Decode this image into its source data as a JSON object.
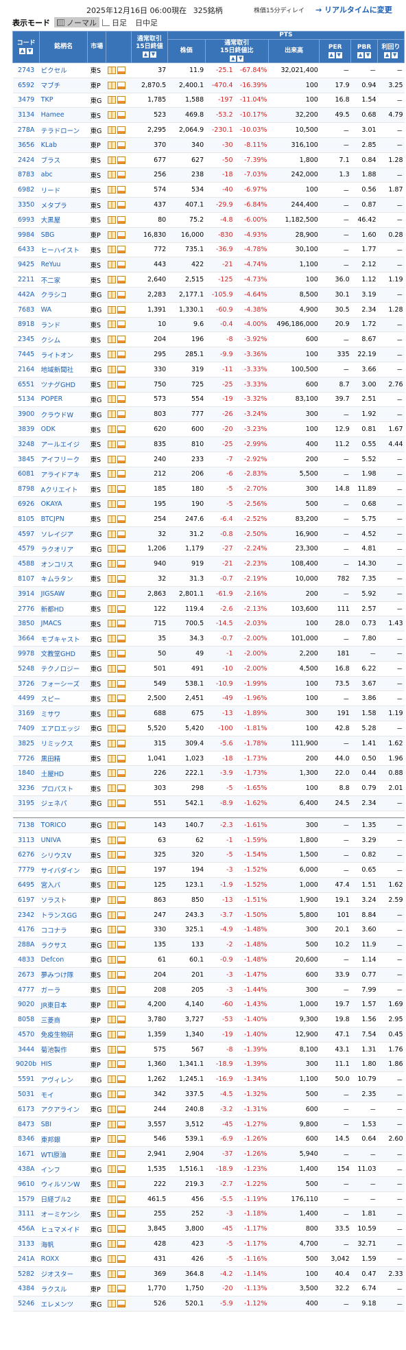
{
  "header": {
    "datetime": "2025年12月16日 06:00現在",
    "count": "325銘柄",
    "delay": "株価15分ディレイ",
    "realtime_link": "→ リアルタイムに変更"
  },
  "mode": {
    "label": "表示モード",
    "normal": "ノーマル",
    "daily": "日足",
    "intraday": "日中足"
  },
  "columns": {
    "code": "コード",
    "name": "銘柄名",
    "market": "市場",
    "prev_close": "通常取引\n15日終値",
    "pts": "PTS",
    "price": "株価",
    "change": "通常取引\n15日終値比",
    "volume": "出来高",
    "per": "PER",
    "pbr": "PBR",
    "yield": "利回り"
  },
  "rows": [
    [
      "2743",
      "ピクセル",
      "東S",
      "37",
      "11.9",
      "-25.1",
      "-67.84%",
      "32,021,400",
      "－",
      "－",
      "－"
    ],
    [
      "6592",
      "マブチ",
      "東P",
      "2,870.5",
      "2,400.1",
      "-470.4",
      "-16.39%",
      "100",
      "17.9",
      "0.94",
      "3.25"
    ],
    [
      "3479",
      "TKP",
      "東G",
      "1,785",
      "1,588",
      "-197",
      "-11.04%",
      "100",
      "16.8",
      "1.54",
      "－"
    ],
    [
      "3134",
      "Hamee",
      "東S",
      "523",
      "469.8",
      "-53.2",
      "-10.17%",
      "32,200",
      "49.5",
      "0.68",
      "4.79"
    ],
    [
      "278A",
      "テラドローン",
      "東G",
      "2,295",
      "2,064.9",
      "-230.1",
      "-10.03%",
      "10,500",
      "－",
      "3.01",
      "－"
    ],
    [
      "3656",
      "KLab",
      "東P",
      "370",
      "340",
      "-30",
      "-8.11%",
      "316,100",
      "－",
      "2.85",
      "－"
    ],
    [
      "2424",
      "ブラス",
      "東S",
      "677",
      "627",
      "-50",
      "-7.39%",
      "1,800",
      "7.1",
      "0.84",
      "1.28"
    ],
    [
      "8783",
      "abc",
      "東S",
      "256",
      "238",
      "-18",
      "-7.03%",
      "242,000",
      "1.3",
      "1.88",
      "－"
    ],
    [
      "6982",
      "リード",
      "東S",
      "574",
      "534",
      "-40",
      "-6.97%",
      "100",
      "－",
      "0.56",
      "1.87"
    ],
    [
      "3350",
      "メタプラ",
      "東S",
      "437",
      "407.1",
      "-29.9",
      "-6.84%",
      "244,400",
      "－",
      "0.87",
      "－"
    ],
    [
      "6993",
      "大黒屋",
      "東S",
      "80",
      "75.2",
      "-4.8",
      "-6.00%",
      "1,182,500",
      "－",
      "46.42",
      "－"
    ],
    [
      "9984",
      "SBG",
      "東P",
      "16,830",
      "16,000",
      "-830",
      "-4.93%",
      "28,900",
      "－",
      "1.60",
      "0.28"
    ],
    [
      "6433",
      "ヒーハイスト",
      "東S",
      "772",
      "735.1",
      "-36.9",
      "-4.78%",
      "30,100",
      "－",
      "1.77",
      "－"
    ],
    [
      "9425",
      "ReYuu",
      "東S",
      "443",
      "422",
      "-21",
      "-4.74%",
      "1,100",
      "－",
      "2.12",
      "－"
    ],
    [
      "2211",
      "不二家",
      "東S",
      "2,640",
      "2,515",
      "-125",
      "-4.73%",
      "100",
      "36.0",
      "1.12",
      "1.19"
    ],
    [
      "442A",
      "クラシコ",
      "東G",
      "2,283",
      "2,177.1",
      "-105.9",
      "-4.64%",
      "8,500",
      "30.1",
      "3.19",
      "－"
    ],
    [
      "7683",
      "WA",
      "東G",
      "1,391",
      "1,330.1",
      "-60.9",
      "-4.38%",
      "4,900",
      "30.5",
      "2.34",
      "1.28"
    ],
    [
      "8918",
      "ランド",
      "東S",
      "10",
      "9.6",
      "-0.4",
      "-4.00%",
      "496,186,000",
      "20.9",
      "1.72",
      "－"
    ],
    [
      "2345",
      "クシム",
      "東S",
      "204",
      "196",
      "-8",
      "-3.92%",
      "600",
      "－",
      "8.67",
      "－"
    ],
    [
      "7445",
      "ライトオン",
      "東S",
      "295",
      "285.1",
      "-9.9",
      "-3.36%",
      "100",
      "335",
      "22.19",
      "－"
    ],
    [
      "2164",
      "地域新聞社",
      "東G",
      "330",
      "319",
      "-11",
      "-3.33%",
      "100,500",
      "－",
      "3.66",
      "－"
    ],
    [
      "6551",
      "ツナグGHD",
      "東S",
      "750",
      "725",
      "-25",
      "-3.33%",
      "600",
      "8.7",
      "3.00",
      "2.76"
    ],
    [
      "5134",
      "POPER",
      "東G",
      "573",
      "554",
      "-19",
      "-3.32%",
      "83,100",
      "39.7",
      "2.51",
      "－"
    ],
    [
      "3900",
      "クラウドW",
      "東G",
      "803",
      "777",
      "-26",
      "-3.24%",
      "300",
      "－",
      "1.92",
      "－"
    ],
    [
      "3839",
      "ODK",
      "東S",
      "620",
      "600",
      "-20",
      "-3.23%",
      "100",
      "12.9",
      "0.81",
      "1.67"
    ],
    [
      "3248",
      "アールエイジ",
      "東S",
      "835",
      "810",
      "-25",
      "-2.99%",
      "400",
      "11.2",
      "0.55",
      "4.44"
    ],
    [
      "3845",
      "アイフリーク",
      "東S",
      "240",
      "233",
      "-7",
      "-2.92%",
      "200",
      "－",
      "5.52",
      "－"
    ],
    [
      "6081",
      "アライドアキ",
      "東S",
      "212",
      "206",
      "-6",
      "-2.83%",
      "5,500",
      "－",
      "1.98",
      "－"
    ],
    [
      "8798",
      "Aクリエイト",
      "東S",
      "185",
      "180",
      "-5",
      "-2.70%",
      "300",
      "14.8",
      "11.89",
      "－"
    ],
    [
      "6926",
      "OKAYA",
      "東S",
      "195",
      "190",
      "-5",
      "-2.56%",
      "500",
      "－",
      "0.68",
      "－"
    ],
    [
      "8105",
      "BTCJPN",
      "東S",
      "254",
      "247.6",
      "-6.4",
      "-2.52%",
      "83,200",
      "－",
      "5.75",
      "－"
    ],
    [
      "4597",
      "ソレイジア",
      "東G",
      "32",
      "31.2",
      "-0.8",
      "-2.50%",
      "16,900",
      "－",
      "4.52",
      "－"
    ],
    [
      "4579",
      "ラクオリア",
      "東G",
      "1,206",
      "1,179",
      "-27",
      "-2.24%",
      "23,300",
      "－",
      "4.81",
      "－"
    ],
    [
      "4588",
      "オンコリス",
      "東G",
      "940",
      "919",
      "-21",
      "-2.23%",
      "108,400",
      "－",
      "14.30",
      "－"
    ],
    [
      "8107",
      "キムラタン",
      "東S",
      "32",
      "31.3",
      "-0.7",
      "-2.19%",
      "10,000",
      "782",
      "7.35",
      "－"
    ],
    [
      "3914",
      "JIGSAW",
      "東G",
      "2,863",
      "2,801.1",
      "-61.9",
      "-2.16%",
      "200",
      "－",
      "5.92",
      "－"
    ],
    [
      "2776",
      "新都HD",
      "東S",
      "122",
      "119.4",
      "-2.6",
      "-2.13%",
      "103,600",
      "111",
      "2.57",
      "－"
    ],
    [
      "3850",
      "JMACS",
      "東S",
      "715",
      "700.5",
      "-14.5",
      "-2.03%",
      "100",
      "28.0",
      "0.73",
      "1.43"
    ],
    [
      "3664",
      "モブキャスト",
      "東G",
      "35",
      "34.3",
      "-0.7",
      "-2.00%",
      "101,000",
      "－",
      "7.80",
      "－"
    ],
    [
      "9978",
      "文教堂GHD",
      "東S",
      "50",
      "49",
      "-1",
      "-2.00%",
      "2,200",
      "181",
      "－",
      "－"
    ],
    [
      "5248",
      "テクノロジー",
      "東G",
      "501",
      "491",
      "-10",
      "-2.00%",
      "4,500",
      "16.8",
      "6.22",
      "－"
    ],
    [
      "3726",
      "フォーシーズ",
      "東S",
      "549",
      "538.1",
      "-10.9",
      "-1.99%",
      "100",
      "73.5",
      "3.67",
      "－"
    ],
    [
      "4499",
      "スピー",
      "東S",
      "2,500",
      "2,451",
      "-49",
      "-1.96%",
      "100",
      "－",
      "3.86",
      "－"
    ],
    [
      "3169",
      "ミサワ",
      "東S",
      "688",
      "675",
      "-13",
      "-1.89%",
      "300",
      "191",
      "1.58",
      "1.19"
    ],
    [
      "7409",
      "エアロエッジ",
      "東G",
      "5,520",
      "5,420",
      "-100",
      "-1.81%",
      "100",
      "42.8",
      "5.28",
      "－"
    ],
    [
      "3825",
      "リミックス",
      "東S",
      "315",
      "309.4",
      "-5.6",
      "-1.78%",
      "111,900",
      "－",
      "1.41",
      "1.62"
    ],
    [
      "7726",
      "黒田精",
      "東S",
      "1,041",
      "1,023",
      "-18",
      "-1.73%",
      "200",
      "44.0",
      "0.50",
      "1.96"
    ],
    [
      "1840",
      "土屋HD",
      "東S",
      "226",
      "222.1",
      "-3.9",
      "-1.73%",
      "1,300",
      "22.0",
      "0.44",
      "0.88"
    ],
    [
      "3236",
      "プロパスト",
      "東S",
      "303",
      "298",
      "-5",
      "-1.65%",
      "100",
      "8.8",
      "0.79",
      "2.01"
    ],
    [
      "3195",
      "ジェネパ",
      "東G",
      "551",
      "542.1",
      "-8.9",
      "-1.62%",
      "6,400",
      "24.5",
      "2.34",
      "－"
    ],
    null,
    [
      "7138",
      "TORICO",
      "東G",
      "143",
      "140.7",
      "-2.3",
      "-1.61%",
      "300",
      "－",
      "1.35",
      "－"
    ],
    [
      "3113",
      "UNIVA",
      "東S",
      "63",
      "62",
      "-1",
      "-1.59%",
      "1,800",
      "－",
      "3.29",
      "－"
    ],
    [
      "6276",
      "シリウスV",
      "東S",
      "325",
      "320",
      "-5",
      "-1.54%",
      "1,500",
      "－",
      "0.82",
      "－"
    ],
    [
      "7779",
      "サイバダイン",
      "東G",
      "197",
      "194",
      "-3",
      "-1.52%",
      "6,000",
      "－",
      "0.65",
      "－"
    ],
    [
      "6495",
      "宮入バ",
      "東S",
      "125",
      "123.1",
      "-1.9",
      "-1.52%",
      "1,000",
      "47.4",
      "1.51",
      "1.62"
    ],
    [
      "6197",
      "ソラスト",
      "東P",
      "863",
      "850",
      "-13",
      "-1.51%",
      "1,900",
      "19.1",
      "3.24",
      "2.59"
    ],
    [
      "2342",
      "トランスGG",
      "東G",
      "247",
      "243.3",
      "-3.7",
      "-1.50%",
      "5,800",
      "101",
      "8.84",
      "－"
    ],
    [
      "4176",
      "ココナラ",
      "東G",
      "330",
      "325.1",
      "-4.9",
      "-1.48%",
      "300",
      "20.1",
      "3.60",
      "－"
    ],
    [
      "288A",
      "ラクサス",
      "東G",
      "135",
      "133",
      "-2",
      "-1.48%",
      "500",
      "10.2",
      "11.9",
      "－"
    ],
    [
      "4833",
      "Defcon",
      "東G",
      "61",
      "60.1",
      "-0.9",
      "-1.48%",
      "20,600",
      "－",
      "1.14",
      "－"
    ],
    [
      "2673",
      "夢みつけ隊",
      "東S",
      "204",
      "201",
      "-3",
      "-1.47%",
      "600",
      "33.9",
      "0.77",
      "－"
    ],
    [
      "4777",
      "ガーラ",
      "東S",
      "208",
      "205",
      "-3",
      "-1.44%",
      "300",
      "－",
      "7.99",
      "－"
    ],
    [
      "9020",
      "JR東日本",
      "東P",
      "4,200",
      "4,140",
      "-60",
      "-1.43%",
      "1,000",
      "19.7",
      "1.57",
      "1.69"
    ],
    [
      "8058",
      "三菱商",
      "東P",
      "3,780",
      "3,727",
      "-53",
      "-1.40%",
      "9,300",
      "19.8",
      "1.56",
      "2.95"
    ],
    [
      "4570",
      "免疫生物研",
      "東G",
      "1,359",
      "1,340",
      "-19",
      "-1.40%",
      "12,900",
      "47.1",
      "7.54",
      "0.45"
    ],
    [
      "3444",
      "菊池製作",
      "東S",
      "575",
      "567",
      "-8",
      "-1.39%",
      "8,100",
      "43.1",
      "1.31",
      "1.76"
    ],
    [
      "9020b",
      "HIS",
      "東P",
      "1,360",
      "1,341.1",
      "-18.9",
      "-1.39%",
      "300",
      "11.1",
      "1.80",
      "1.86"
    ],
    [
      "5591",
      "アヴィレン",
      "東G",
      "1,262",
      "1,245.1",
      "-16.9",
      "-1.34%",
      "1,100",
      "50.0",
      "10.79",
      "－"
    ],
    [
      "5031",
      "モイ",
      "東G",
      "342",
      "337.5",
      "-4.5",
      "-1.32%",
      "500",
      "－",
      "2.35",
      "－"
    ],
    [
      "6173",
      "アクアライン",
      "東G",
      "244",
      "240.8",
      "-3.2",
      "-1.31%",
      "600",
      "－",
      "－",
      "－"
    ],
    [
      "8473",
      "SBI",
      "東P",
      "3,557",
      "3,512",
      "-45",
      "-1.27%",
      "9,800",
      "－",
      "1.53",
      "－"
    ],
    [
      "8346",
      "東邦銀",
      "東P",
      "546",
      "539.1",
      "-6.9",
      "-1.26%",
      "600",
      "14.5",
      "0.64",
      "2.60"
    ],
    [
      "1671",
      "WTI原油",
      "東E",
      "2,941",
      "2,904",
      "-37",
      "-1.26%",
      "5,940",
      "－",
      "－",
      "－"
    ],
    [
      "438A",
      "インフ",
      "東G",
      "1,535",
      "1,516.1",
      "-18.9",
      "-1.23%",
      "1,400",
      "154",
      "11.03",
      "－"
    ],
    [
      "9610",
      "ウィルソンW",
      "東S",
      "222",
      "219.3",
      "-2.7",
      "-1.22%",
      "500",
      "－",
      "－",
      "－"
    ],
    [
      "1579",
      "日経ブル2",
      "東E",
      "461.5",
      "456",
      "-5.5",
      "-1.19%",
      "176,110",
      "－",
      "－",
      "－"
    ],
    [
      "3111",
      "オーミケンシ",
      "東S",
      "255",
      "252",
      "-3",
      "-1.18%",
      "1,400",
      "－",
      "1.81",
      "－"
    ],
    [
      "456A",
      "ヒュマメイド",
      "東G",
      "3,845",
      "3,800",
      "-45",
      "-1.17%",
      "800",
      "33.5",
      "10.59",
      "－"
    ],
    [
      "3133",
      "海帆",
      "東G",
      "428",
      "423",
      "-5",
      "-1.17%",
      "4,700",
      "－",
      "32.71",
      "－"
    ],
    [
      "241A",
      "ROXX",
      "東G",
      "431",
      "426",
      "-5",
      "-1.16%",
      "500",
      "3,042",
      "1.59",
      "－"
    ],
    [
      "5282",
      "ジオスター",
      "東S",
      "369",
      "364.8",
      "-4.2",
      "-1.14%",
      "100",
      "40.4",
      "0.47",
      "2.33"
    ],
    [
      "4384",
      "ラクスル",
      "東P",
      "1,770",
      "1,750",
      "-20",
      "-1.13%",
      "3,500",
      "32.2",
      "6.74",
      "－"
    ],
    [
      "5246",
      "エレメンツ",
      "東G",
      "526",
      "520.1",
      "-5.9",
      "-1.12%",
      "400",
      "－",
      "9.18",
      "－"
    ]
  ]
}
